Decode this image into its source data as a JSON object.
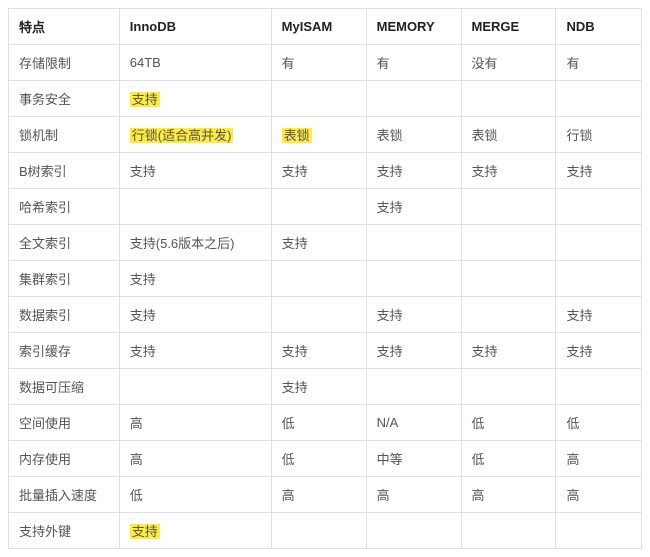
{
  "chart_data": {
    "type": "table",
    "title": "",
    "columns": [
      "特点",
      "InnoDB",
      "MyISAM",
      "MEMORY",
      "MERGE",
      "NDB"
    ],
    "rows": [
      {
        "feature": "存储限制",
        "cells": [
          {
            "t": "64TB"
          },
          {
            "t": "有"
          },
          {
            "t": "有"
          },
          {
            "t": "没有"
          },
          {
            "t": "有"
          }
        ]
      },
      {
        "feature": "事务安全",
        "cells": [
          {
            "t": "支持",
            "hl": true
          },
          {
            "t": ""
          },
          {
            "t": ""
          },
          {
            "t": ""
          },
          {
            "t": ""
          }
        ]
      },
      {
        "feature": "锁机制",
        "cells": [
          {
            "t": "行锁(适合高并发)",
            "hl": true
          },
          {
            "t": "表锁",
            "hl": true
          },
          {
            "t": "表锁"
          },
          {
            "t": "表锁"
          },
          {
            "t": "行锁"
          }
        ]
      },
      {
        "feature": "B树索引",
        "cells": [
          {
            "t": "支持"
          },
          {
            "t": "支持"
          },
          {
            "t": "支持"
          },
          {
            "t": "支持"
          },
          {
            "t": "支持"
          }
        ]
      },
      {
        "feature": "哈希索引",
        "cells": [
          {
            "t": ""
          },
          {
            "t": ""
          },
          {
            "t": "支持"
          },
          {
            "t": ""
          },
          {
            "t": ""
          }
        ]
      },
      {
        "feature": "全文索引",
        "cells": [
          {
            "t": "支持(5.6版本之后)"
          },
          {
            "t": "支持"
          },
          {
            "t": ""
          },
          {
            "t": ""
          },
          {
            "t": ""
          }
        ]
      },
      {
        "feature": "集群索引",
        "cells": [
          {
            "t": "支持"
          },
          {
            "t": ""
          },
          {
            "t": ""
          },
          {
            "t": ""
          },
          {
            "t": ""
          }
        ]
      },
      {
        "feature": "数据索引",
        "cells": [
          {
            "t": "支持"
          },
          {
            "t": ""
          },
          {
            "t": "支持"
          },
          {
            "t": ""
          },
          {
            "t": "支持"
          }
        ]
      },
      {
        "feature": "索引缓存",
        "cells": [
          {
            "t": "支持"
          },
          {
            "t": "支持"
          },
          {
            "t": "支持"
          },
          {
            "t": "支持"
          },
          {
            "t": "支持"
          }
        ]
      },
      {
        "feature": "数据可压缩",
        "cells": [
          {
            "t": ""
          },
          {
            "t": "支持"
          },
          {
            "t": ""
          },
          {
            "t": ""
          },
          {
            "t": ""
          }
        ]
      },
      {
        "feature": "空间使用",
        "cells": [
          {
            "t": "高"
          },
          {
            "t": "低"
          },
          {
            "t": "N/A"
          },
          {
            "t": "低"
          },
          {
            "t": "低"
          }
        ]
      },
      {
        "feature": "内存使用",
        "cells": [
          {
            "t": "高"
          },
          {
            "t": "低"
          },
          {
            "t": "中等"
          },
          {
            "t": "低"
          },
          {
            "t": "高"
          }
        ]
      },
      {
        "feature": "批量插入速度",
        "cells": [
          {
            "t": "低"
          },
          {
            "t": "高"
          },
          {
            "t": "高"
          },
          {
            "t": "高"
          },
          {
            "t": "高"
          }
        ]
      },
      {
        "feature": "支持外键",
        "cells": [
          {
            "t": "支持",
            "hl": true
          },
          {
            "t": ""
          },
          {
            "t": ""
          },
          {
            "t": ""
          },
          {
            "t": ""
          }
        ]
      }
    ]
  }
}
